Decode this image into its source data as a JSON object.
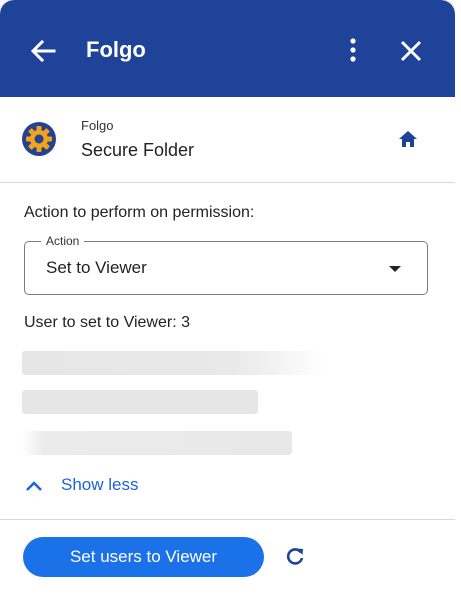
{
  "header": {
    "title": "Folgo",
    "color": "#1f4399"
  },
  "app": {
    "small_label": "Folgo",
    "name": "Secure Folder"
  },
  "form": {
    "action_prompt": "Action to perform on permission:",
    "select_legend": "Action",
    "select_value": "Set to Viewer",
    "users_label": "User to set to Viewer: 3"
  },
  "toggle": {
    "show_less_label": "Show less"
  },
  "footer": {
    "primary_label": "Set users to Viewer",
    "primary_color": "#1b72e8"
  },
  "icons": {
    "back": "arrow-left-icon",
    "more": "more-vert-icon",
    "close": "close-icon",
    "logo": "gear-logo-icon",
    "home": "home-icon",
    "caret": "dropdown-caret-icon",
    "show_less": "chevron-up-icon",
    "refresh": "refresh-icon"
  }
}
